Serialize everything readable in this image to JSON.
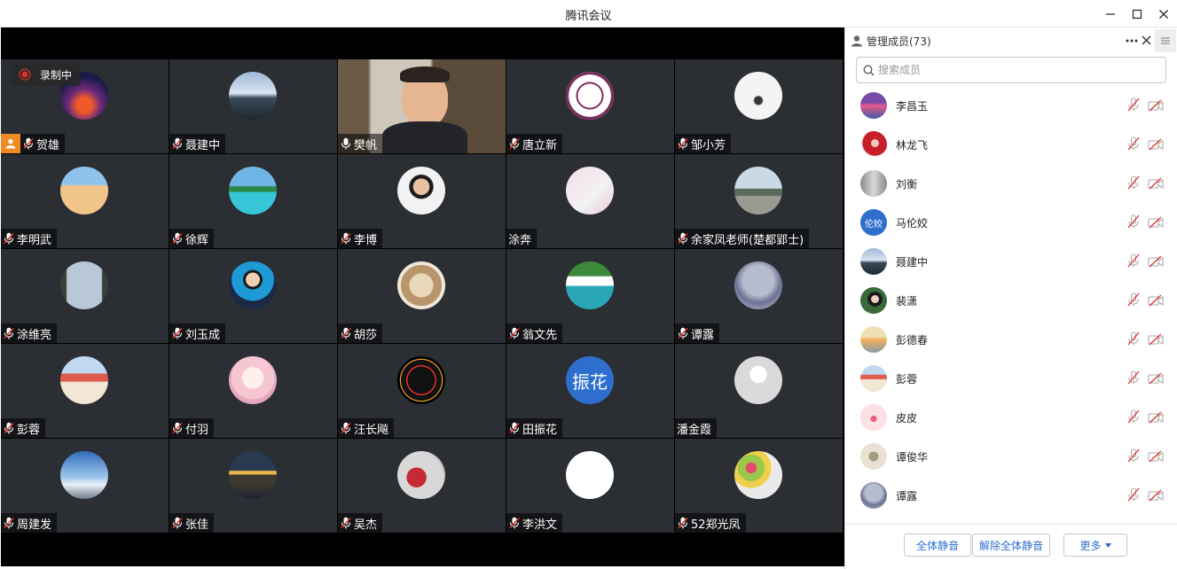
{
  "window": {
    "title": "腾讯会议"
  },
  "recording": {
    "label": "录制中"
  },
  "tiles": [
    {
      "name": "贺雄",
      "avatar": "galaxy",
      "host": true
    },
    {
      "name": "聂建中",
      "avatar": "road-sky"
    },
    {
      "name": "樊帆",
      "avatar": "video",
      "video": true
    },
    {
      "name": "唐立新",
      "avatar": "university-emblem"
    },
    {
      "name": "邹小芳",
      "avatar": "girl-photo"
    },
    {
      "name": "李明武",
      "avatar": "desert"
    },
    {
      "name": "徐辉",
      "avatar": "beach"
    },
    {
      "name": "李博",
      "avatar": "man-portrait"
    },
    {
      "name": "涂奔",
      "avatar": "baby",
      "nomic": true
    },
    {
      "name": "余家凤老师(楚都郢士)",
      "avatar": "street"
    },
    {
      "name": "涂维亮",
      "avatar": "arch"
    },
    {
      "name": "刘玉成",
      "avatar": "suit-man"
    },
    {
      "name": "胡莎",
      "avatar": "dog"
    },
    {
      "name": "翁文先",
      "avatar": "waterfall"
    },
    {
      "name": "谭露",
      "avatar": "tree"
    },
    {
      "name": "彭蓉",
      "avatar": "cartoon-banner"
    },
    {
      "name": "付羽",
      "avatar": "anime-girl"
    },
    {
      "name": "汪长飚",
      "avatar": "speedometer"
    },
    {
      "name": "田振花",
      "avatar": "text-avatar",
      "avatar_text": "振花"
    },
    {
      "name": "潘金霞",
      "avatar": "default-person",
      "nomic": true
    },
    {
      "name": "周建发",
      "avatar": "sky"
    },
    {
      "name": "张佳",
      "avatar": "night-lights"
    },
    {
      "name": "吴杰",
      "avatar": "red-object"
    },
    {
      "name": "李洪文",
      "avatar": "white"
    },
    {
      "name": "52郑光凤",
      "avatar": "flowers"
    }
  ],
  "panel": {
    "title": "管理成员(73)",
    "search_placeholder": "搜索成员",
    "members": [
      {
        "name": "李昌玉",
        "avatar": "sunset-purple"
      },
      {
        "name": "林龙飞",
        "avatar": "red-girl"
      },
      {
        "name": "刘衡",
        "avatar": "gray-building"
      },
      {
        "name": "马伦姣",
        "avatar": "text-avatar",
        "avatar_text": "伦姣"
      },
      {
        "name": "聂建中",
        "avatar": "road-sky"
      },
      {
        "name": "裴潇",
        "avatar": "green-girl"
      },
      {
        "name": "彭德春",
        "avatar": "sunrise"
      },
      {
        "name": "彭蓉",
        "avatar": "cartoon-banner"
      },
      {
        "name": "皮皮",
        "avatar": "pink-figure"
      },
      {
        "name": "谭俊华",
        "avatar": "painting"
      },
      {
        "name": "谭露",
        "avatar": "tree"
      }
    ],
    "footer": {
      "mute_all": "全体静音",
      "unmute_all": "解除全体静音",
      "more": "更多"
    }
  },
  "colors": {
    "accent": "#2e6fce",
    "host": "#f08a24",
    "tile_bg": "#2b2e33",
    "mute_red": "#e0322b"
  }
}
